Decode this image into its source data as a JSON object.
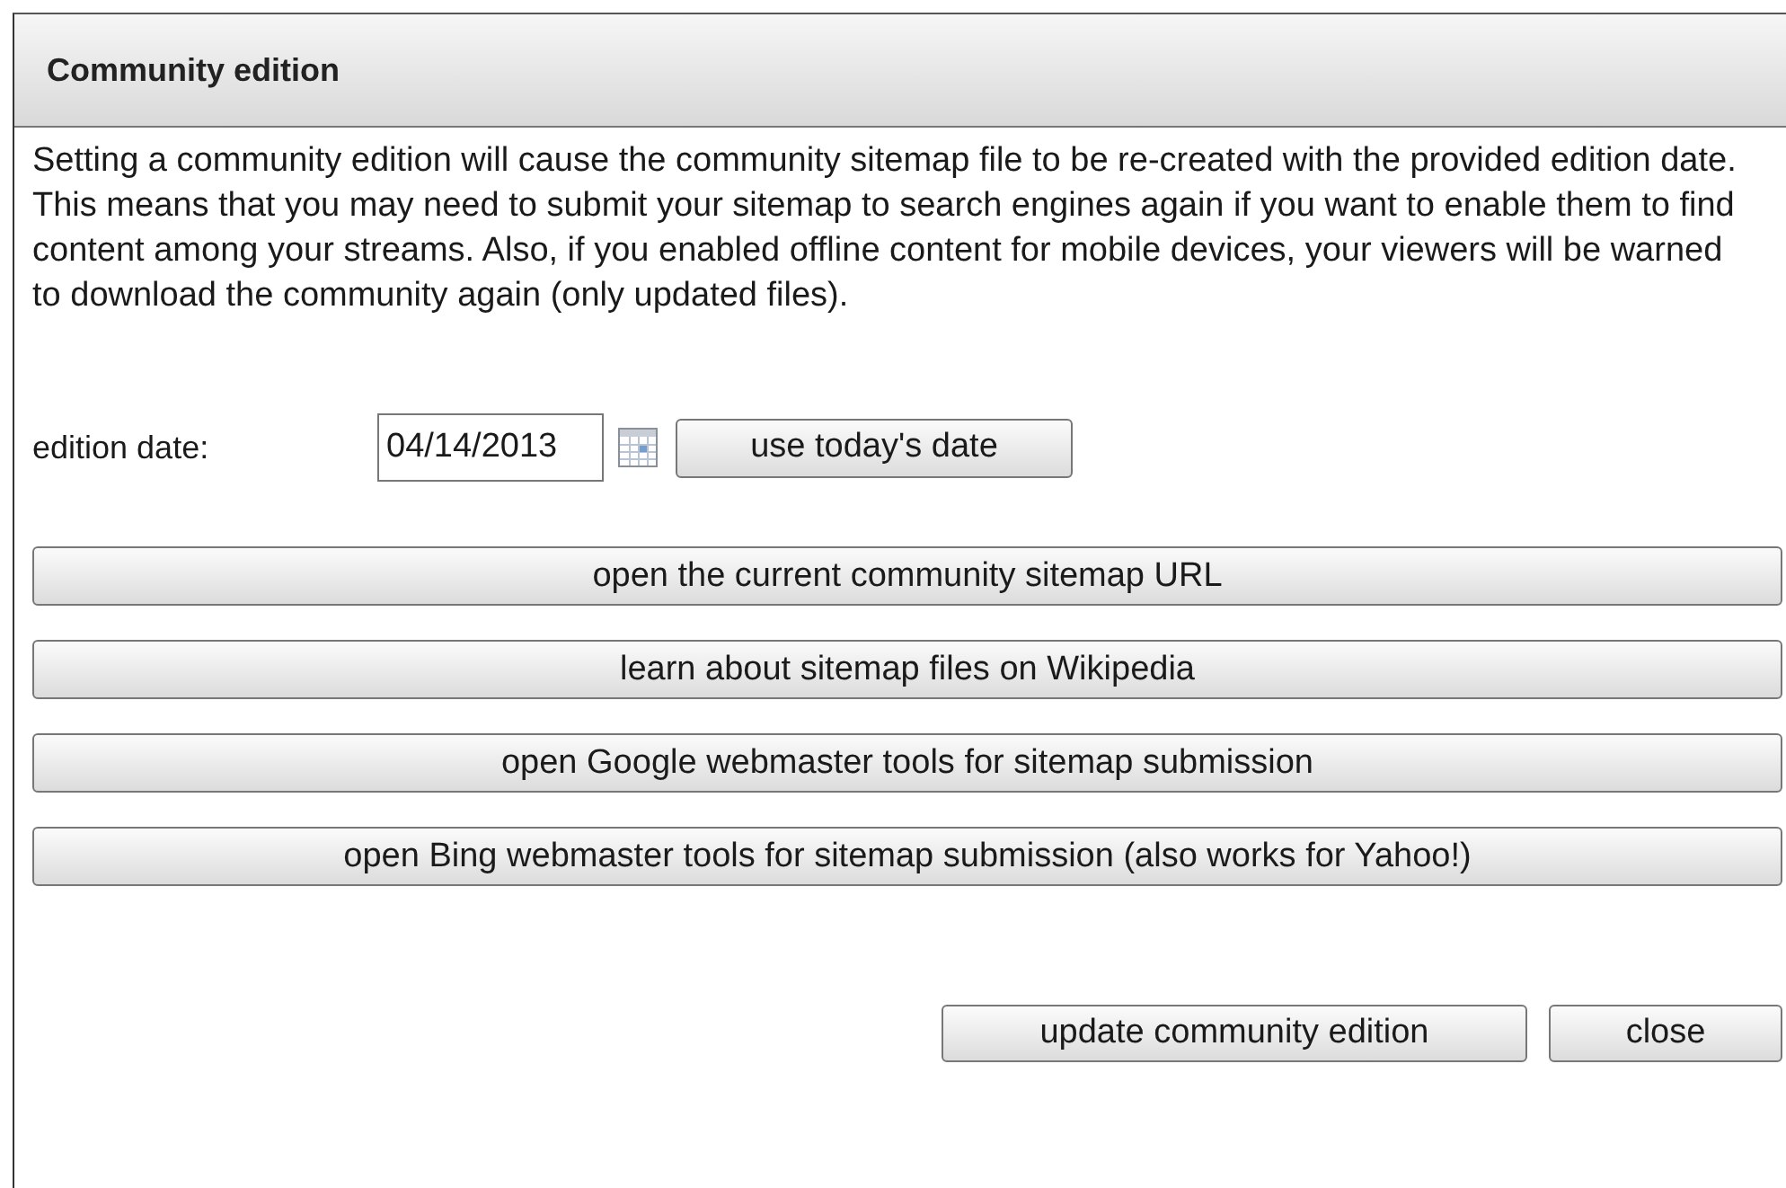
{
  "dialog": {
    "title": "Community edition"
  },
  "description": "Setting a community edition will cause the community sitemap file to be re-created with the provided edition date. This means that you may need to submit your sitemap to search engines again if you want to enable them to find content among your streams. Also, if you enabled offline content for mobile devices, your viewers will be warned to download the community again (only updated files).",
  "edition_date": {
    "label": "edition date:",
    "value": "04/14/2013",
    "today_button": "use today's date"
  },
  "link_buttons": [
    "open the current community sitemap URL",
    "learn about sitemap files on Wikipedia",
    "open Google webmaster tools for sitemap submission",
    "open Bing webmaster tools for sitemap submission (also works for Yahoo!)"
  ],
  "buttons": [
    "update community edition",
    "close"
  ]
}
